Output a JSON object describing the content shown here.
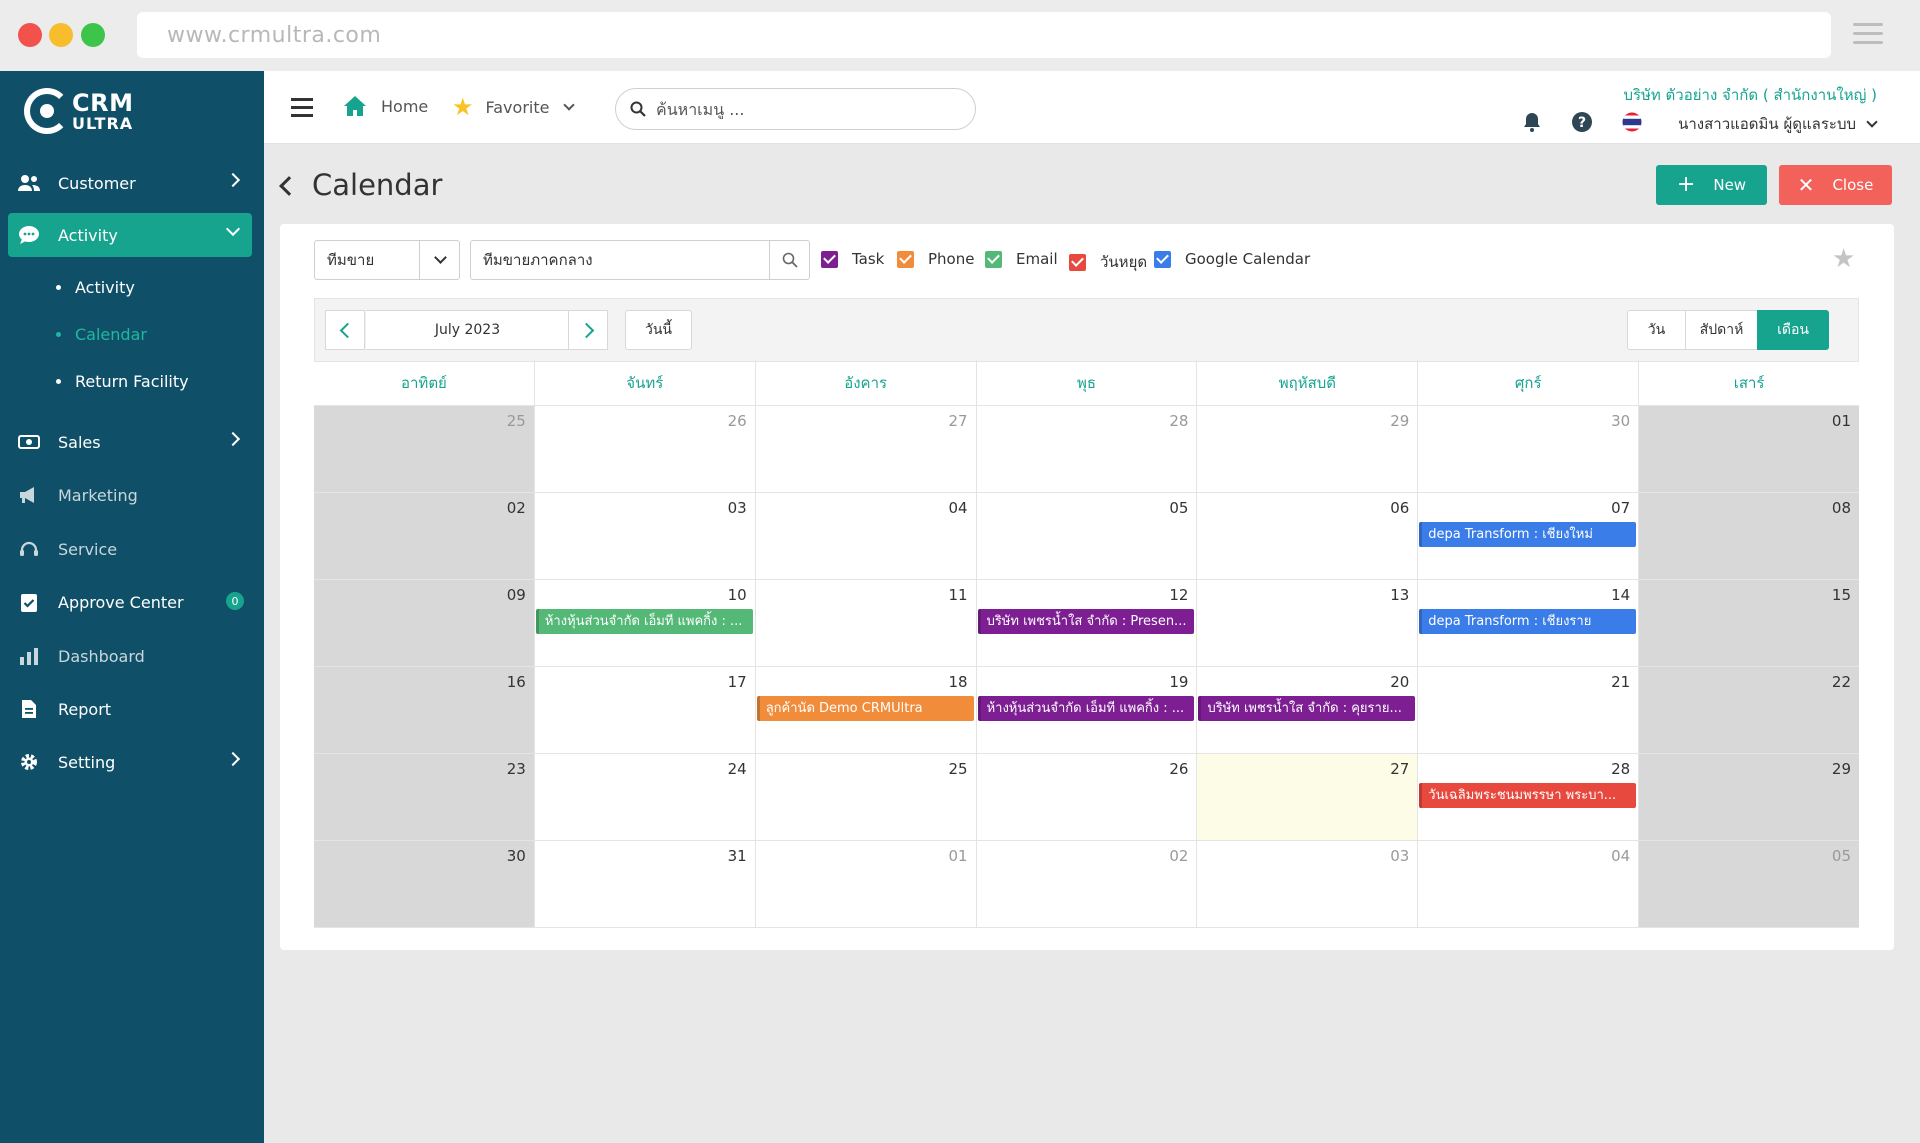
{
  "browser": {
    "url": "www.crmultra.com"
  },
  "logo": {
    "line1": "CRM",
    "line2": "ULTRA"
  },
  "sidebar": {
    "items": [
      {
        "label": "Customer"
      },
      {
        "label": "Activity"
      },
      {
        "label": "Sales"
      },
      {
        "label": "Marketing"
      },
      {
        "label": "Service"
      },
      {
        "label": "Approve Center",
        "badge": "0"
      },
      {
        "label": "Dashboard"
      },
      {
        "label": "Report"
      },
      {
        "label": "Setting"
      }
    ],
    "activity_sub": [
      {
        "label": "Activity"
      },
      {
        "label": "Calendar"
      },
      {
        "label": "Return Facility"
      }
    ]
  },
  "topbar": {
    "home": "Home",
    "favorite": "Favorite",
    "search_placeholder": "ค้นหาเมนู ...",
    "company": "บริษัท ตัวอย่าง จำกัด ( สำนักงานใหญ่ )",
    "user": "นางสาวแอดมิน ผู้ดูแลระบบ"
  },
  "page": {
    "title": "Calendar",
    "new_label": "New",
    "close_label": "Close"
  },
  "filters": {
    "team_select": "ทีมขาย",
    "team_value": "ทีมขายภาคกลาง",
    "checkboxes": [
      {
        "label": "Task",
        "color": "#7d1f93"
      },
      {
        "label": "Phone",
        "color": "#f08c3a"
      },
      {
        "label": "Email",
        "color": "#54b877"
      },
      {
        "label": "วันหยุด",
        "color": "#e8493f"
      },
      {
        "label": "Google Calendar",
        "color": "#3b7de8"
      }
    ]
  },
  "calendar": {
    "month_label": "July 2023",
    "today_label": "วันนี้",
    "views": [
      "วัน",
      "สัปดาห์",
      "เดือน"
    ],
    "active_view": "เดือน",
    "weekdays": [
      "อาทิตย์",
      "จันทร์",
      "อังคาร",
      "พุธ",
      "พฤหัสบดี",
      "ศุกร์",
      "เสาร์"
    ],
    "weeks": [
      [
        "25",
        "26",
        "27",
        "28",
        "29",
        "30",
        "01"
      ],
      [
        "02",
        "03",
        "04",
        "05",
        "06",
        "07",
        "08"
      ],
      [
        "09",
        "10",
        "11",
        "12",
        "13",
        "14",
        "15"
      ],
      [
        "16",
        "17",
        "18",
        "19",
        "20",
        "21",
        "22"
      ],
      [
        "23",
        "24",
        "25",
        "26",
        "27",
        "28",
        "29"
      ],
      [
        "30",
        "31",
        "01",
        "02",
        "03",
        "04",
        "05"
      ]
    ],
    "events": [
      {
        "week": 1,
        "day": 5,
        "title": "depa Transform : เชียงใหม่",
        "color": "blue"
      },
      {
        "week": 2,
        "day": 1,
        "title": "ห้างหุ้นส่วนจำกัด เอ็มที แพคกิ้ง : ...",
        "color": "green"
      },
      {
        "week": 2,
        "day": 3,
        "title": "บริษัท เพชรน้ำใส จำกัด : Presen...",
        "color": "purple"
      },
      {
        "week": 2,
        "day": 5,
        "title": "depa Transform : เชียงราย",
        "color": "blue"
      },
      {
        "week": 3,
        "day": 2,
        "title": "ลูกค้านัด Demo CRMUltra",
        "color": "orange"
      },
      {
        "week": 3,
        "day": 3,
        "title": "ห้างหุ้นส่วนจำกัด เอ็มที แพคกิ้ง : ...",
        "color": "purple"
      },
      {
        "week": 3,
        "day": 4,
        "title": "บริษัท เพชรน้ำใส จำกัด : คุยราย...",
        "color": "purple"
      },
      {
        "week": 4,
        "day": 5,
        "title": "วันเฉลิมพระชนมพรรษา พระบา...",
        "color": "red"
      }
    ]
  }
}
